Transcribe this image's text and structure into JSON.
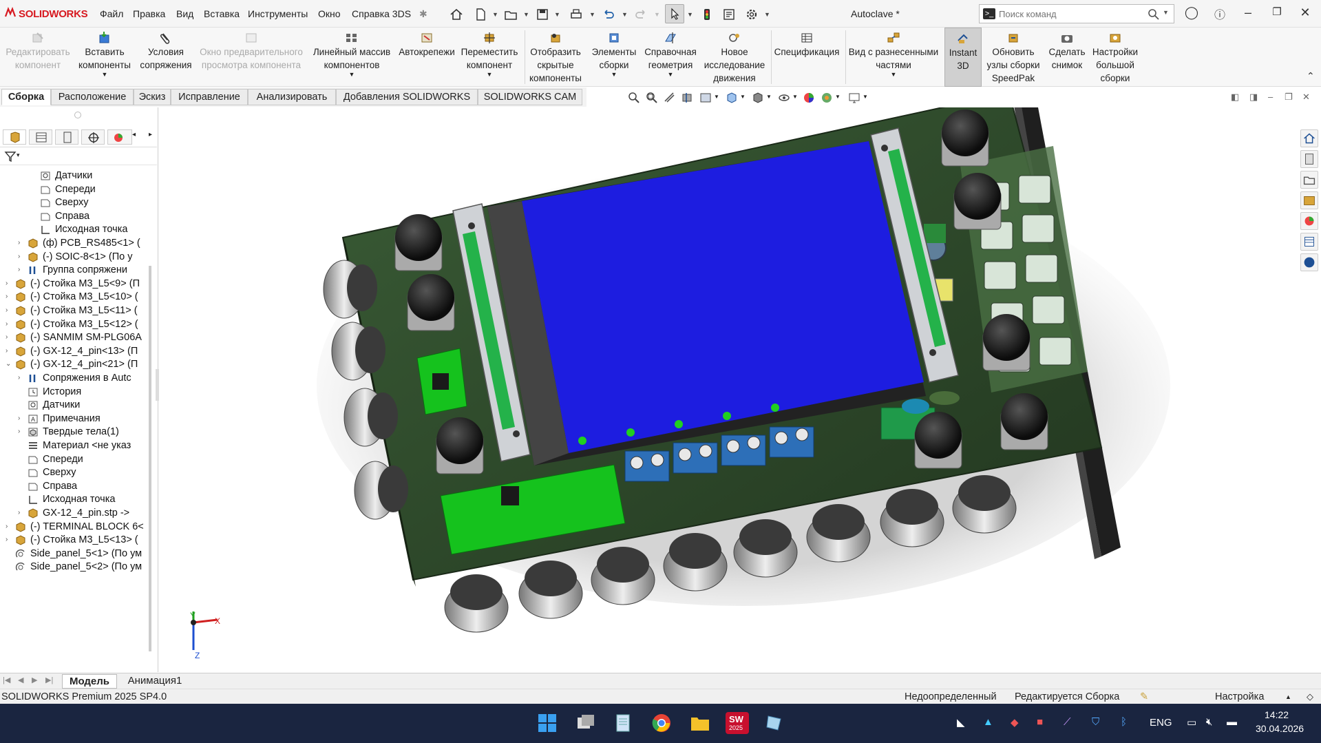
{
  "app": {
    "logo": "SOLIDWORKS",
    "document_title": "Autoclave *",
    "menu": [
      "Файл",
      "Правка",
      "Вид",
      "Вставка",
      "Инструменты",
      "Окно",
      "Справка 3DS"
    ],
    "command_search_placeholder": "Поиск команд"
  },
  "ribbon": {
    "buttons": [
      {
        "label": "Редактировать компонент",
        "enabled": false
      },
      {
        "label": "Вставить компоненты",
        "enabled": true
      },
      {
        "label": "Условия сопряжения",
        "enabled": true
      },
      {
        "label": "Окно предварительного просмотра компонента",
        "enabled": false
      },
      {
        "label": "Линейный массив компонентов",
        "enabled": true
      },
      {
        "label": "Автокрепежи",
        "enabled": true
      },
      {
        "label": "Переместить компонент",
        "enabled": true
      },
      {
        "label": "Отобразить скрытые компоненты",
        "enabled": true
      },
      {
        "label": "Элементы сборки",
        "enabled": true
      },
      {
        "label": "Справочная геометрия",
        "enabled": true
      },
      {
        "label": "Новое исследование движения",
        "enabled": true
      },
      {
        "label": "Спецификация",
        "enabled": true
      },
      {
        "label": "Вид с разнесенными частями",
        "enabled": true
      },
      {
        "label": "Instant 3D",
        "enabled": true,
        "active": true
      },
      {
        "label": "Обновить узлы сборки SpeedPak",
        "enabled": true
      },
      {
        "label": "Сделать снимок",
        "enabled": true
      },
      {
        "label": "Настройки большой сборки",
        "enabled": true
      }
    ]
  },
  "tabs": [
    "Сборка",
    "Расположение",
    "Эскиз",
    "Исправление",
    "Анализировать",
    "Добавления SOLIDWORKS",
    "SOLIDWORKS CAM"
  ],
  "tree": [
    {
      "indent": 2,
      "arrow": "",
      "icon": "sensor",
      "label": "Датчики"
    },
    {
      "indent": 2,
      "arrow": "",
      "icon": "plane",
      "label": "Спереди"
    },
    {
      "indent": 2,
      "arrow": "",
      "icon": "plane",
      "label": "Сверху"
    },
    {
      "indent": 2,
      "arrow": "",
      "icon": "plane",
      "label": "Справа"
    },
    {
      "indent": 2,
      "arrow": "",
      "icon": "origin",
      "label": "Исходная точка"
    },
    {
      "indent": 1,
      "arrow": "›",
      "icon": "part",
      "label": "(ф) PCB_RS485<1> ("
    },
    {
      "indent": 1,
      "arrow": "›",
      "icon": "part",
      "label": "(-) SOIC-8<1> (По у"
    },
    {
      "indent": 1,
      "arrow": "›",
      "icon": "mate",
      "label": "Группа сопряжени"
    },
    {
      "indent": 0,
      "arrow": "›",
      "icon": "part",
      "label": "(-) Стойка M3_L5<9> (П"
    },
    {
      "indent": 0,
      "arrow": "›",
      "icon": "part",
      "label": "(-) Стойка M3_L5<10> ("
    },
    {
      "indent": 0,
      "arrow": "›",
      "icon": "part",
      "label": "(-) Стойка M3_L5<11> ("
    },
    {
      "indent": 0,
      "arrow": "›",
      "icon": "part",
      "label": "(-) Стойка M3_L5<12> ("
    },
    {
      "indent": 0,
      "arrow": "›",
      "icon": "part",
      "label": "(-) SANMIM SM-PLG06A"
    },
    {
      "indent": 0,
      "arrow": "›",
      "icon": "part",
      "label": "(-) GX-12_4_pin<13> (П"
    },
    {
      "indent": 0,
      "arrow": "⌄",
      "icon": "part",
      "label": "(-) GX-12_4_pin<21> (П"
    },
    {
      "indent": 1,
      "arrow": "›",
      "icon": "mate",
      "label": "Сопряжения в Autc"
    },
    {
      "indent": 1,
      "arrow": "",
      "icon": "history",
      "label": "История"
    },
    {
      "indent": 1,
      "arrow": "",
      "icon": "sensor",
      "label": "Датчики"
    },
    {
      "indent": 1,
      "arrow": "›",
      "icon": "note",
      "label": "Примечания"
    },
    {
      "indent": 1,
      "arrow": "›",
      "icon": "solid",
      "label": "Твердые тела(1)"
    },
    {
      "indent": 1,
      "arrow": "",
      "icon": "material",
      "label": "Материал <не указ"
    },
    {
      "indent": 1,
      "arrow": "",
      "icon": "plane",
      "label": "Спереди"
    },
    {
      "indent": 1,
      "arrow": "",
      "icon": "plane",
      "label": "Сверху"
    },
    {
      "indent": 1,
      "arrow": "",
      "icon": "plane",
      "label": "Справа"
    },
    {
      "indent": 1,
      "arrow": "",
      "icon": "origin",
      "label": "Исходная точка"
    },
    {
      "indent": 1,
      "arrow": "›",
      "icon": "part",
      "label": "GX-12_4_pin.stp ->"
    },
    {
      "indent": 0,
      "arrow": "›",
      "icon": "part",
      "label": "(-) TERMINAL BLOCK 6<"
    },
    {
      "indent": 0,
      "arrow": "›",
      "icon": "part",
      "label": "(-) Стойка M3_L5<13> ("
    },
    {
      "indent": 0,
      "arrow": "",
      "icon": "sketchpart",
      "label": "Side_panel_5<1> (По ум"
    },
    {
      "indent": 0,
      "arrow": "",
      "icon": "sketchpart",
      "label": "Side_panel_5<2> (По ум"
    }
  ],
  "axes": {
    "x": "X",
    "y": "Y",
    "z": "Z"
  },
  "bottom_tabs": [
    "Модель",
    "Анимация1"
  ],
  "status": {
    "product": "SOLIDWORKS Premium 2025 SP4.0",
    "definition": "Недоопределенный",
    "mode": "Редактируется Сборка",
    "settings": "Настройка"
  },
  "taskbar": {
    "lang": "ENG",
    "time": "14:22",
    "date": "30.04.2026",
    "sw_badge": "2025"
  }
}
